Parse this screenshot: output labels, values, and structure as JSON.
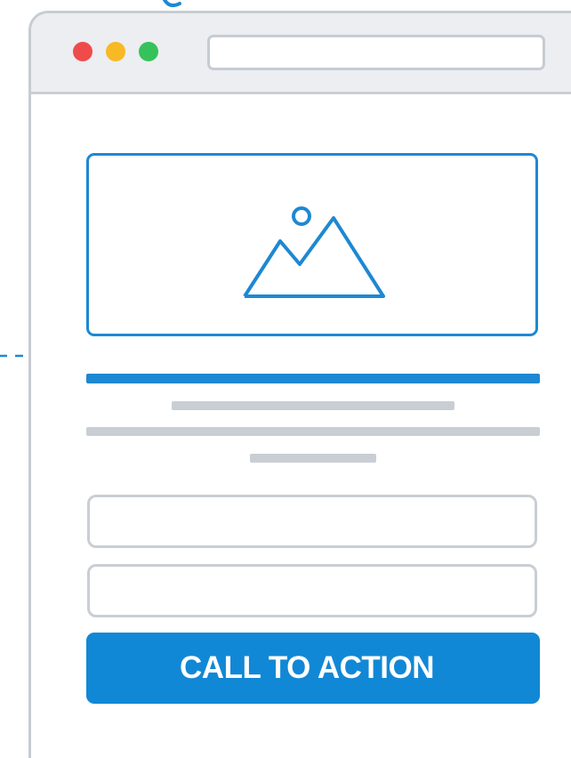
{
  "window": {
    "controls": [
      "close",
      "minimize",
      "maximize"
    ],
    "address_bar": {
      "value": ""
    }
  },
  "content": {
    "hero_image": {
      "icon": "image-placeholder-icon"
    },
    "form": {
      "fields": [
        {
          "value": ""
        },
        {
          "value": ""
        }
      ],
      "cta_label": "CALL TO ACTION"
    }
  },
  "colors": {
    "accent": "#1188d6",
    "outline": "#1e88d2",
    "placeholder_gray": "#c9ced5",
    "titlebar": "#eceef1",
    "close": "#ef4b4b",
    "minimize": "#f7b924",
    "maximize": "#36c25a"
  }
}
